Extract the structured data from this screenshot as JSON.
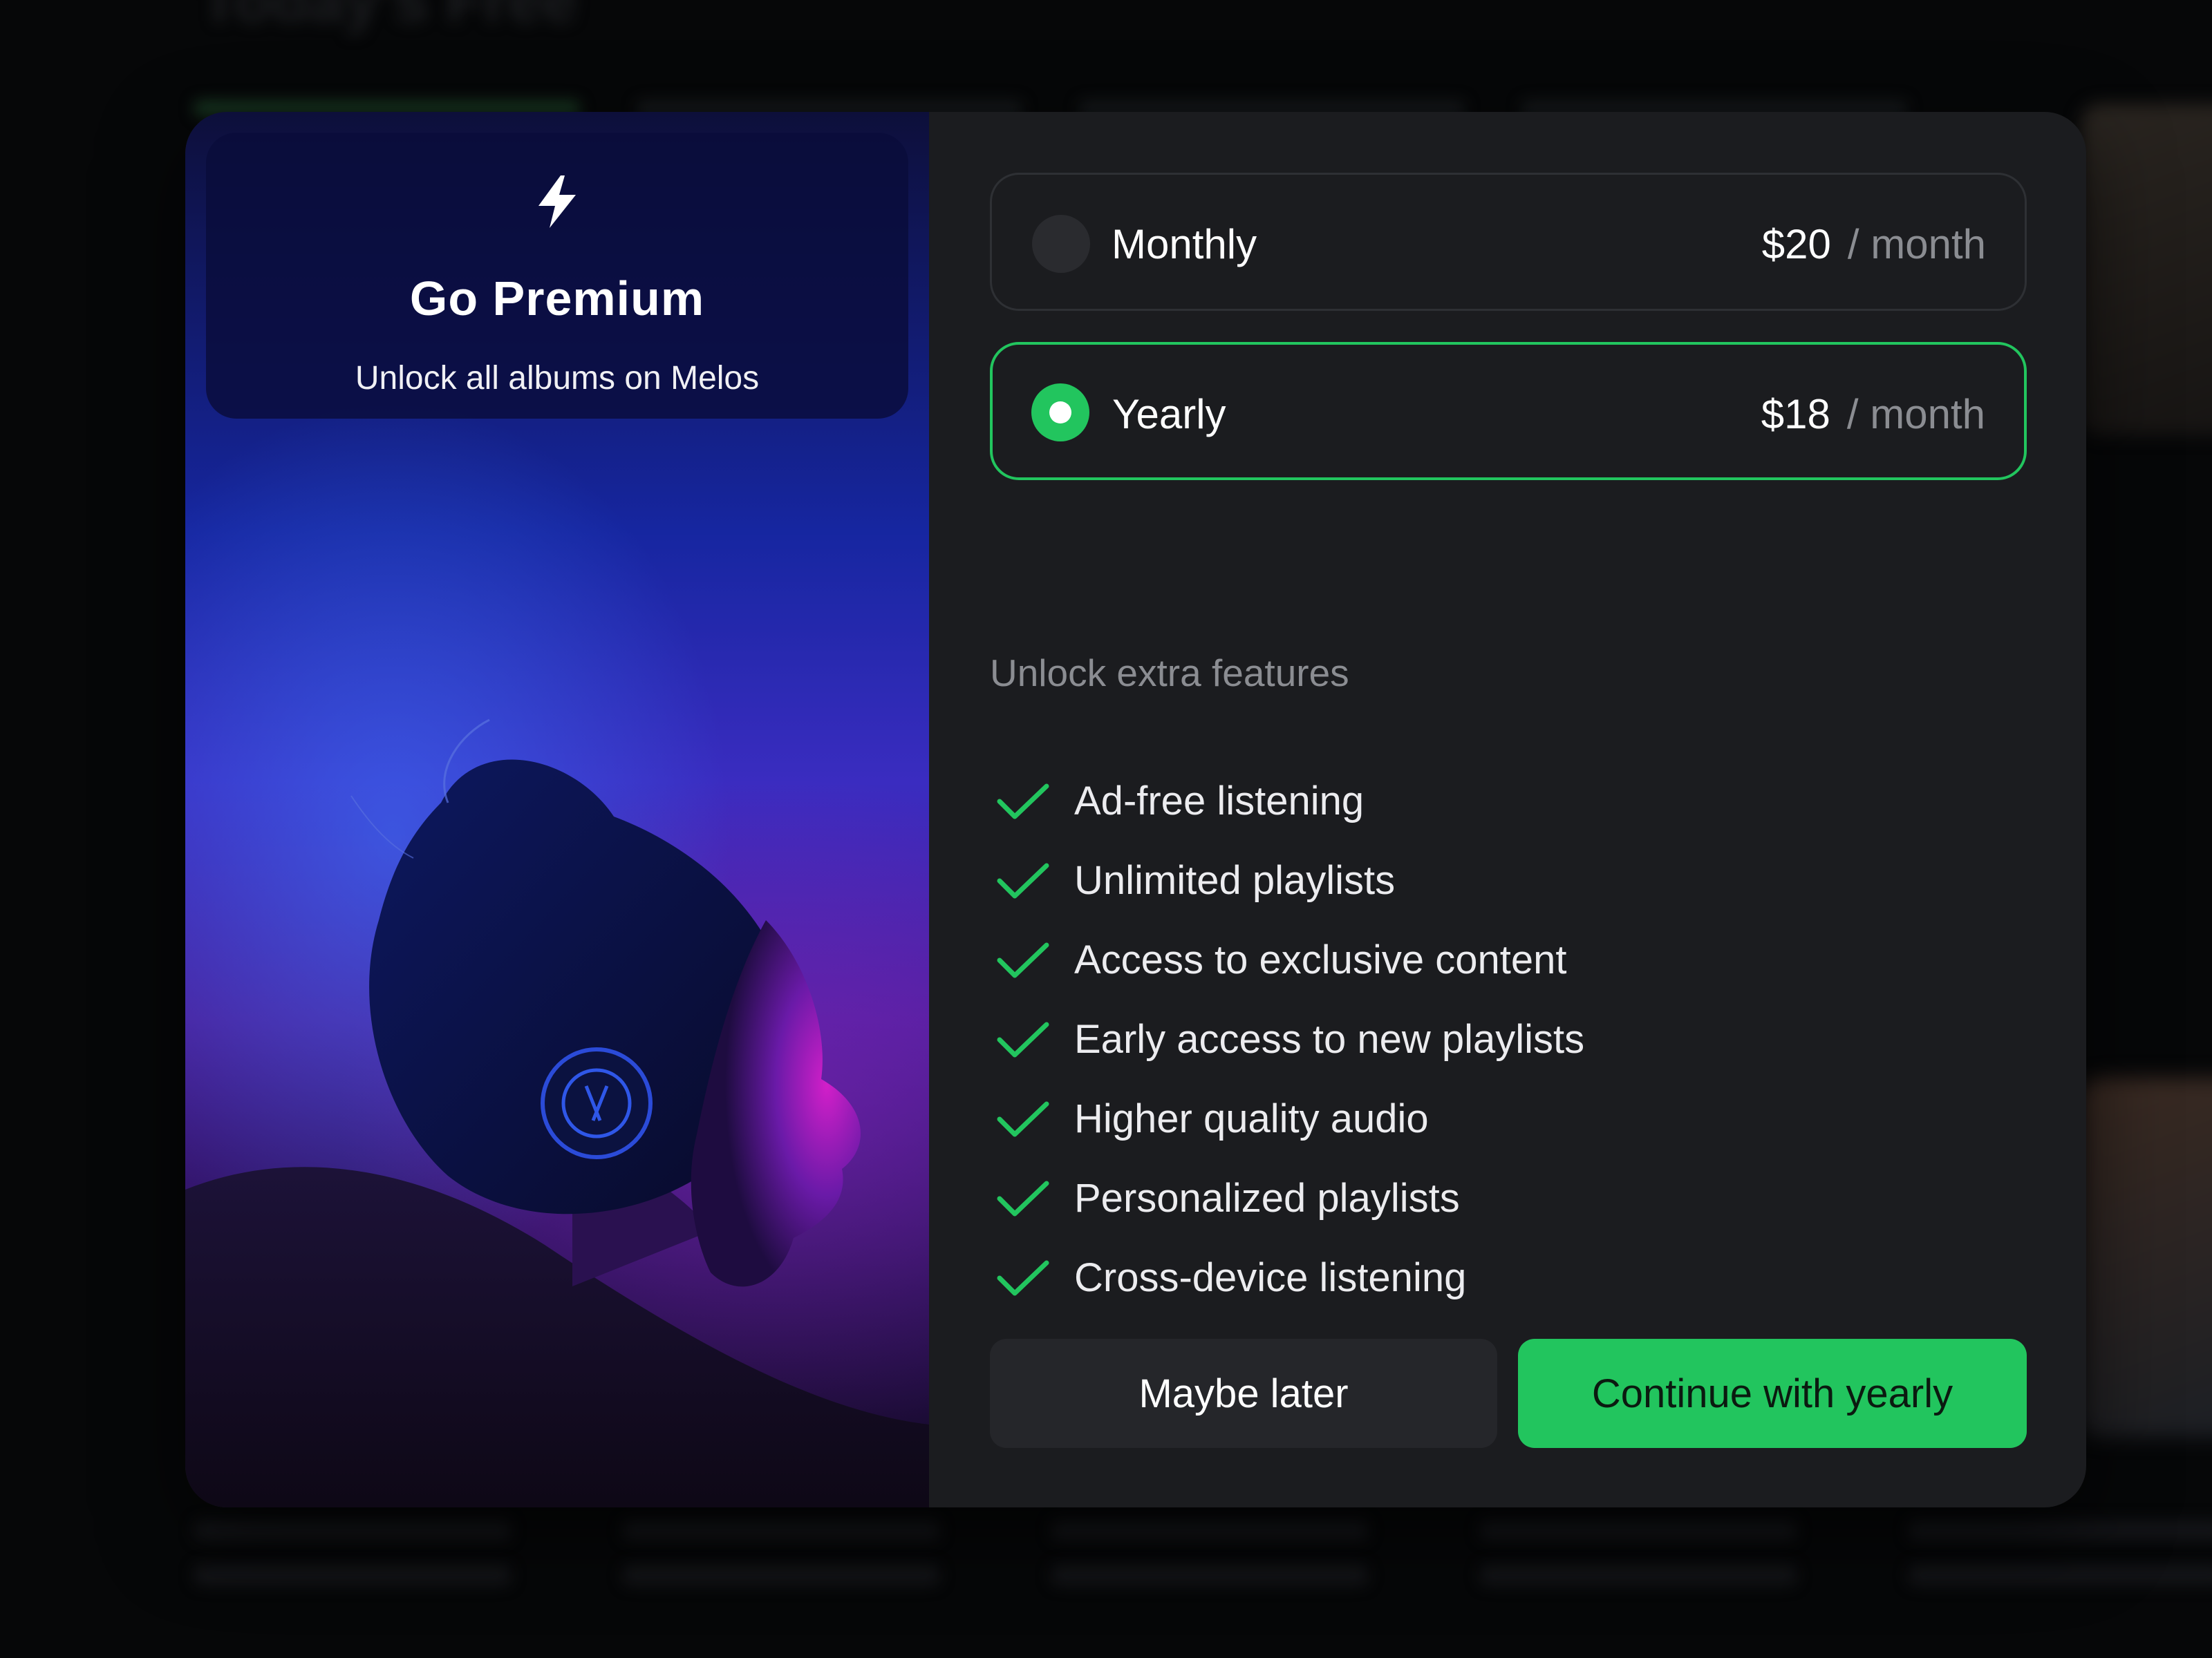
{
  "background_app": {
    "title": "Today's Free"
  },
  "modal": {
    "header": {
      "icon": "lightning-bolt-icon",
      "title": "Go Premium",
      "subtitle": "Unlock all albums on Melos"
    },
    "plans": [
      {
        "name": "Monthly",
        "price": "$20",
        "period": "/ month",
        "selected": false
      },
      {
        "name": "Yearly",
        "price": "$18",
        "period": "/ month",
        "selected": true
      }
    ],
    "features_heading": "Unlock extra features",
    "features": [
      "Ad-free listening",
      "Unlimited playlists",
      "Access to exclusive content",
      "Early access to new playlists",
      "Higher quality audio",
      "Personalized playlists",
      "Cross-device listening"
    ],
    "buttons": {
      "secondary": "Maybe later",
      "primary": "Continue with yearly"
    },
    "colors": {
      "accent": "#22c55e",
      "panel": "#1b1c1f",
      "muted_text": "#8b8d92",
      "header_card": "#0a0c3a"
    }
  }
}
